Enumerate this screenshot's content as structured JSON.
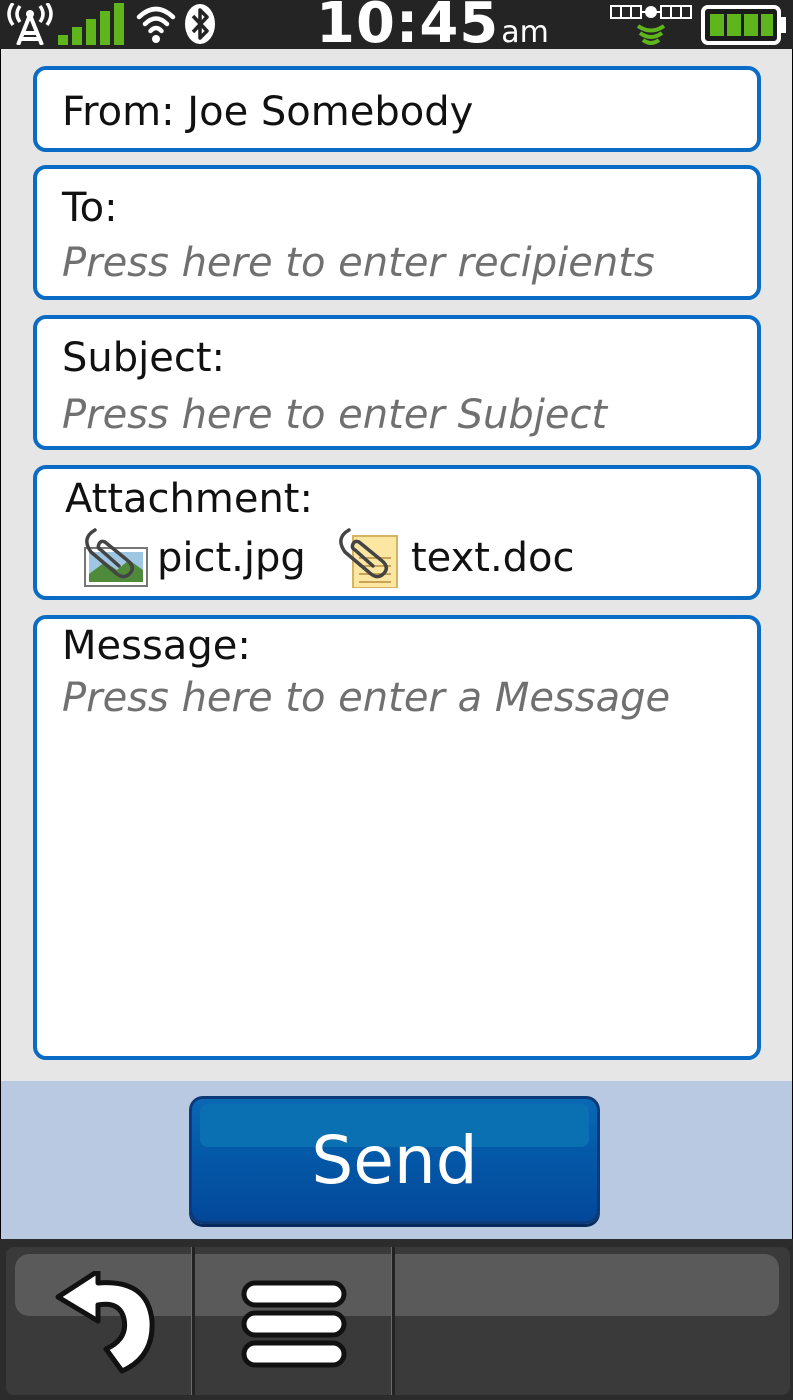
{
  "status_bar": {
    "time": "10:45",
    "ampm": "am",
    "icons": [
      "antenna-icon",
      "signal-bars-icon",
      "wifi-icon",
      "bluetooth-icon",
      "gps-satellite-icon",
      "battery-icon"
    ]
  },
  "form": {
    "from_label": "From: Joe Somebody",
    "to_label": "To:",
    "to_placeholder": "Press here to enter recipients",
    "subject_label": "Subject:",
    "subject_placeholder": "Press here to enter Subject",
    "attachment_label": "Attachment:",
    "attachments": [
      {
        "name": "pict.jpg",
        "icon": "image-attachment-icon"
      },
      {
        "name": "text.doc",
        "icon": "document-attachment-icon"
      }
    ],
    "message_label": "Message:",
    "message_placeholder": "Press here to enter a Message"
  },
  "send_label": "Send",
  "bottom_bar": {
    "buttons": [
      "back-icon",
      "menu-icon"
    ]
  },
  "colors": {
    "field_border": "#0a6cc4",
    "send_button": "#0459a8",
    "send_area": "#b8c9e1",
    "signal_green": "#5fb51c"
  }
}
